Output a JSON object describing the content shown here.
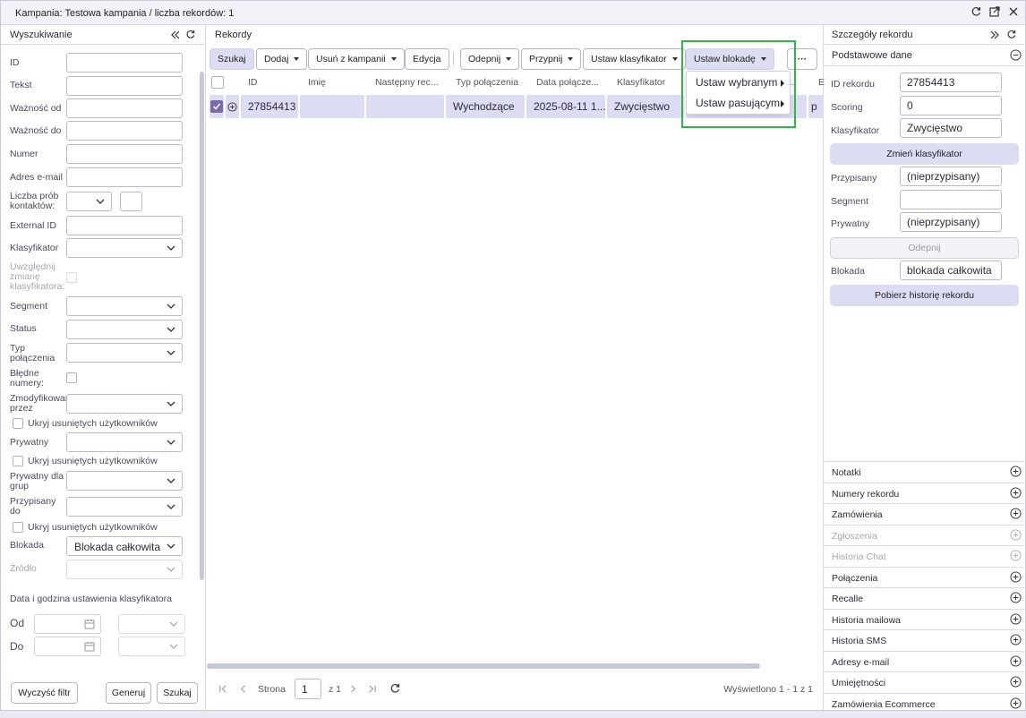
{
  "window": {
    "title": "Kampania: Testowa kampania / liczba rekordów: 1"
  },
  "search": {
    "title": "Wyszukiwanie",
    "fields": {
      "id": "ID",
      "tekst": "Tekst",
      "waznosc_od": "Ważność od",
      "waznosc_do": "Ważność do",
      "numer": "Numer",
      "email": "Adres e-mail",
      "liczba_prob": "Liczba prób kontaktów:",
      "external_id": "External ID",
      "klasyfikator": "Klasyfikator",
      "uwzglednij": "Uwzględnij zmianę klasyfikatora:",
      "segment": "Segment",
      "status": "Status",
      "typ_polaczenia": "Typ połączenia",
      "bledne": "Błędne numery:",
      "zmodyfikowany": "Zmodyfikowany przez",
      "ukryj1": "Ukryj usuniętych użytkowników",
      "prywatny": "Prywatny",
      "ukryj2": "Ukryj usuniętych użytkowników",
      "prywatny_grup": "Prywatny dla grup",
      "przypisany": "Przypisany do",
      "ukryj3": "Ukryj usuniętych użytkowników",
      "blokada": "Blokada",
      "blokada_value": "Blokada całkowita",
      "zrodlo": "Źródło"
    },
    "date_section": "Data i godzina ustawienia klasyfikatora",
    "od": "Od",
    "do": "Do",
    "buttons": {
      "clear": "Wyczyść filtr",
      "generate": "Generuj",
      "search": "Szukaj"
    }
  },
  "records": {
    "title": "Rekordy",
    "toolbar": {
      "szukaj": "Szukaj",
      "dodaj": "Dodaj",
      "usun": "Usuń z kampanii",
      "edycja": "Edycja",
      "odepnij": "Odepnij",
      "przypnij": "Przypnij",
      "ustaw_klasyfikator": "Ustaw klasyfikator",
      "ustaw_blokade": "Ustaw blokadę",
      "more": "···"
    },
    "columns": [
      "ID",
      "Imię",
      "Następny rec...",
      "Typ połączenia",
      "Data połącze...",
      "Klasyfikator",
      "...a...",
      "E"
    ],
    "row": {
      "id": "27854413",
      "imie": "",
      "nastepny": "",
      "typ": "Wychodzące",
      "data": "2025-08-11 1...",
      "klasyfikator": "Zwycięstwo",
      "extra": "p"
    },
    "menu": [
      "Ustaw wybranym",
      "Ustaw pasującym"
    ],
    "pager": {
      "strona": "Strona",
      "page": "1",
      "of": "z 1",
      "summary": "Wyświetlono 1 - 1 z 1"
    }
  },
  "details": {
    "title": "Szczegóły rekordu",
    "section": "Podstawowe dane",
    "fields": {
      "id_label": "ID rekordu",
      "id_value": "27854413",
      "scoring_label": "Scoring",
      "scoring_value": "0",
      "klas_label": "Klasyfikator",
      "klas_value": "Zwycięstwo",
      "przyp_label": "Przypisany",
      "przyp_value": "(nieprzypisany)",
      "seg_label": "Segment",
      "seg_value": "",
      "pryw_label": "Prywatny",
      "pryw_value": "(nieprzypisany)",
      "blok_label": "Blokada",
      "blok_value": "blokada całkowita"
    },
    "buttons": {
      "zmien": "Zmień klasyfikator",
      "odepnij": "Odepnij",
      "historia": "Pobierz historię rekordu"
    },
    "sections": [
      "Notatki",
      "Numery rekordu",
      "Zamówienia",
      "Zgłoszenia",
      "Historia Chat",
      "Połączenia",
      "Recalle",
      "Historia mailowa",
      "Historia SMS",
      "Adresy e-mail",
      "Umiejętności",
      "Zamówienia Ecommerce"
    ],
    "disabled_sections": [
      "Zgłoszenia",
      "Historia Chat"
    ]
  },
  "colors": {
    "accent": "#dcdcf3",
    "highlight": "#33b34a",
    "checkbox_selected": "#7a6aa8"
  }
}
